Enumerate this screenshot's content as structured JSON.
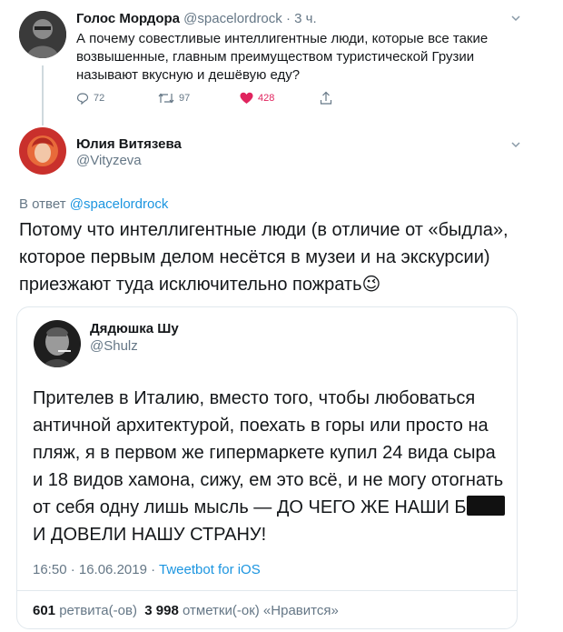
{
  "tweet1": {
    "author_name": "Голос Мордора",
    "handle": "@spacelordrock",
    "time": "· 3 ч.",
    "text": "А почему совестливые интеллигентные люди, которые все такие возвышенные, главным преимуществом туристической Грузии называют вкусную и дешёвую еду?",
    "replies": "72",
    "retweets": "97",
    "likes": "428",
    "like_color": "#e0245e"
  },
  "tweet2": {
    "author_name": "Юлия Витязева",
    "handle": "@Vityzeva",
    "reply_prefix": "В ответ",
    "reply_to": "@spacelordrock",
    "text": "Потому что интеллигентные люди (в отличие от «быдла», которое первым делом несётся в музеи и на экскурсии) приезжают туда исключительно пожрать",
    "emoji": "😉"
  },
  "quoted": {
    "author_name": "Дядюшка Шу",
    "handle": "@Shulz",
    "text_before": "Прителев в Италию, вместо того, чтобы любоваться античной архитектурой, поехать в горы или просто на пляж, я в первом же гипермаркете купил 24 вида сыра и 18 видов хамона, сижу, ем это всё, и не могу отогнать от себя одну лишь мысль — ДО ЧЕГО ЖЕ НАШИ Б",
    "text_after": "И ДОВЕЛИ НАШУ СТРАНУ!",
    "timestamp": "16:50 · 16.06.2019 ·",
    "client": "Tweetbot for iOS",
    "retweets_count": "601",
    "retweets_label": "ретвита(-ов)",
    "likes_count": "3 998",
    "likes_label": "отметки(-ок) «Нравится»"
  },
  "colors": {
    "link": "#1b95e0",
    "muted": "#657786",
    "border": "#e1e8ed"
  }
}
